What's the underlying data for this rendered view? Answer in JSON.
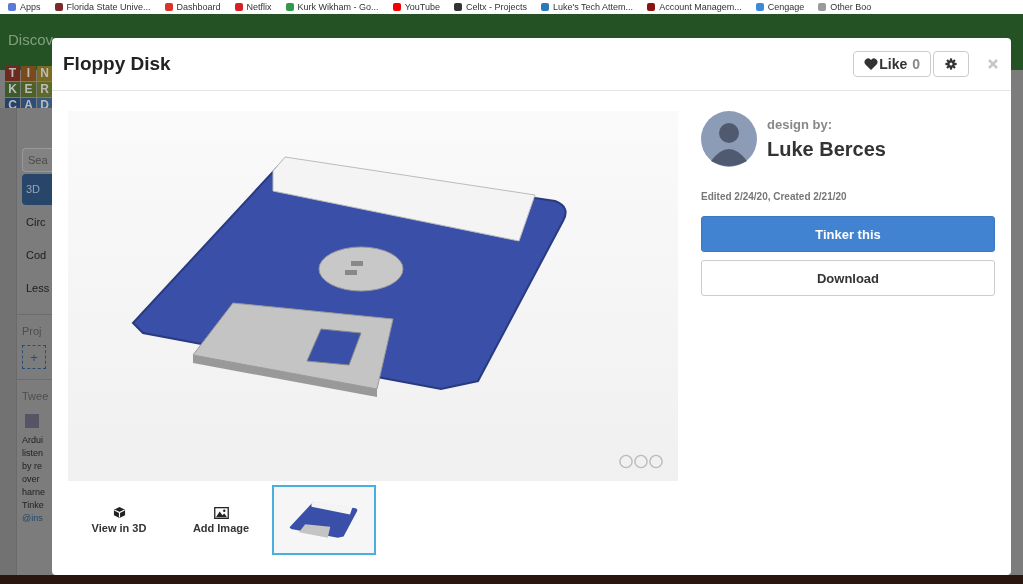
{
  "bookmarks": [
    {
      "label": "Apps",
      "color": "#5a7ad8"
    },
    {
      "label": "Florida State Unive...",
      "color": "#7a2a2a"
    },
    {
      "label": "Dashboard",
      "color": "#d8342c"
    },
    {
      "label": "Netflix",
      "color": "#d81f26"
    },
    {
      "label": "Kurk Wikham - Go...",
      "color": "#2f9a49"
    },
    {
      "label": "YouTube",
      "color": "#f40000"
    },
    {
      "label": "Celtx - Projects",
      "color": "#333333"
    },
    {
      "label": "Luke's Tech Attem...",
      "color": "#2a7ab8"
    },
    {
      "label": "Account Managem...",
      "color": "#8a1414"
    },
    {
      "label": "Cengage",
      "color": "#3a8ad8"
    },
    {
      "label": "Other Boo",
      "color": "#9a9a9a"
    }
  ],
  "banner": {
    "text": "Discov"
  },
  "sidebar": {
    "logo": [
      {
        "letter": "T",
        "color": "#6e2a1e"
      },
      {
        "letter": "I",
        "color": "#7a4a1a"
      },
      {
        "letter": "N",
        "color": "#7a6a22"
      },
      {
        "letter": "K",
        "color": "#3c5a2a"
      },
      {
        "letter": "E",
        "color": "#4e6224"
      },
      {
        "letter": "R",
        "color": "#5e6a2a"
      },
      {
        "letter": "C",
        "color": "#24426a"
      },
      {
        "letter": "A",
        "color": "#2e4e78"
      },
      {
        "letter": "D",
        "color": "#3a5a80"
      }
    ],
    "search_placeholder": "Sea",
    "items": [
      {
        "label": "3D",
        "selected": true
      },
      {
        "label": "Circ",
        "selected": false
      },
      {
        "label": "Cod",
        "selected": false
      },
      {
        "label": "Less",
        "selected": false
      }
    ],
    "projects_heading": "Proj",
    "add_button": "+",
    "tweets_heading": "Twee",
    "tweet_lines": [
      "Ardui",
      "listen",
      "by re",
      "over",
      "harne",
      "Tinke"
    ],
    "tweet_link": "@ins"
  },
  "modal": {
    "title": "Floppy Disk",
    "like": {
      "label": "Like",
      "count": "0"
    },
    "designer": {
      "caption": "design by:",
      "name": "Luke Berces"
    },
    "dates": "Edited 2/24/20, Created 2/21/20",
    "actions": [
      {
        "kind": "primary",
        "label": "Tinker this"
      },
      {
        "kind": "secondary",
        "label": "Download"
      }
    ],
    "media_tabs": [
      {
        "kind": "view3d",
        "label": "View in 3D",
        "selected": false
      },
      {
        "kind": "add-image",
        "label": "Add Image",
        "selected": false
      },
      {
        "kind": "thumbnail",
        "selected": true
      }
    ]
  }
}
